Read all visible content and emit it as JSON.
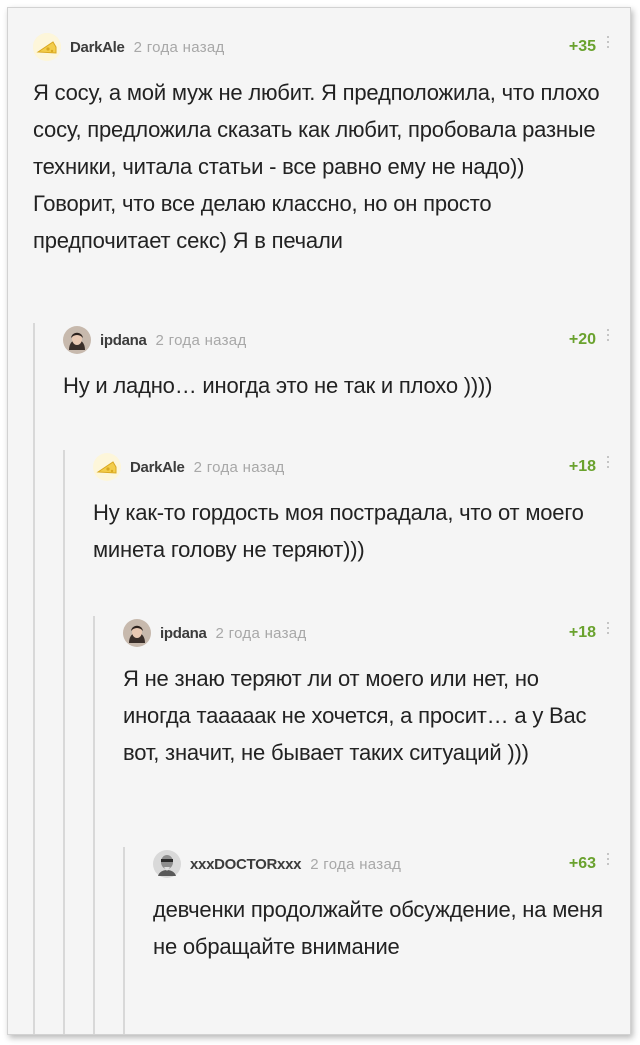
{
  "comments": [
    {
      "username": "DarkAle",
      "time": "2 года назад",
      "rating": "+35",
      "avatar_icon": "cheese-icon",
      "text": "Я сосу, а мой муж не любит. Я предположила, что плохо сосу, предложила сказать как любит, пробовала разные техники, читала статьи - все равно ему не надо)) Говорит, что все делаю классно, но он просто предпочитает секс) Я в печали"
    },
    {
      "username": "ipdana",
      "time": "2 года назад",
      "rating": "+20",
      "avatar_icon": "user-photo-icon",
      "text": "Ну и ладно… иногда это не так и плохо ))))"
    },
    {
      "username": "DarkAle",
      "time": "2 года назад",
      "rating": "+18",
      "avatar_icon": "cheese-icon",
      "text": "Ну как-то гордость моя пострадала, что от моего минета голову не теряют)))"
    },
    {
      "username": "ipdana",
      "time": "2 года назад",
      "rating": "+18",
      "avatar_icon": "user-photo-icon",
      "text": "Я не знаю теряют ли от моего или нет, но иногда тааааак не хочется, а просит… а у Вас вот, значит, не бывает таких ситуаций )))"
    },
    {
      "username": "xxxDOCTORxxx",
      "time": "2 года назад",
      "rating": "+63",
      "avatar_icon": "user-photo-icon",
      "text": "девченки продолжайте обсуждение, на меня не обращайте внимание"
    }
  ],
  "colors": {
    "rating": "#6aa22e",
    "username": "#3c3c3c",
    "time": "#a8a8a8",
    "thread_line": "#d8d8d8"
  }
}
